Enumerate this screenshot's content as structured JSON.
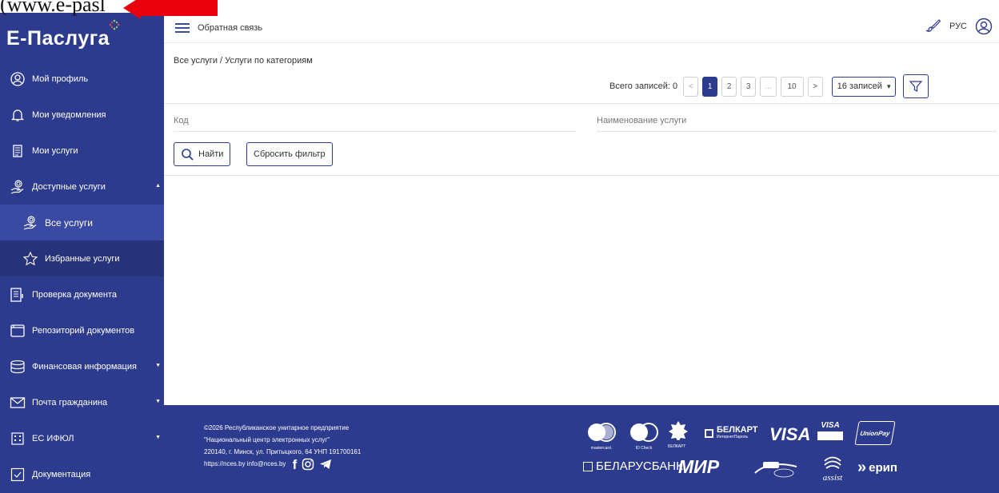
{
  "overlay": {
    "text": "(www.e-pasl"
  },
  "logo": {
    "text": "Е-Паслуга"
  },
  "sidebar": {
    "items": [
      {
        "label": "Мой профиль"
      },
      {
        "label": "Мои уведомления"
      },
      {
        "label": "Мои услуги"
      },
      {
        "label": "Доступные услуги"
      },
      {
        "label": "Все услуги"
      },
      {
        "label": "Избранные услуги"
      },
      {
        "label": "Проверка документа"
      },
      {
        "label": "Репозиторий документов"
      },
      {
        "label": "Финансовая информация"
      },
      {
        "label": "Почта гражданина"
      },
      {
        "label": "ЕС ИФЮЛ"
      },
      {
        "label": "Документация"
      }
    ]
  },
  "header": {
    "feedback": "Обратная связь",
    "lang": "РУС"
  },
  "breadcrumb": "Все услуги / Услуги по категориям",
  "pager": {
    "total_label": "Всего записей: 0",
    "prev": "<",
    "pages": [
      "1",
      "2",
      "3",
      "...",
      "10"
    ],
    "next": ">",
    "per_page": "16 записей"
  },
  "filters": {
    "code_label": "Код",
    "name_label": "Наименование услуги"
  },
  "buttons": {
    "find": "Найти",
    "reset": "Сбросить фильтр"
  },
  "footer": {
    "line1": "©2026 Республиканское унитарное предприятие",
    "line2": "\"Национальный центр электронных услуг\"",
    "line3": "220140, г. Минск, ул. Притыцкого, 64  УНП 191700161",
    "line4": "https://nces.by  info@nces.by",
    "payments": {
      "mastercard": "mastercard.",
      "mc_idcheck": "ID Check",
      "belkart_small": "БЕЛКАРТ",
      "belkart": "БЕЛКАРТ",
      "belkart_sub": "ИнтернетПароль",
      "visa": "VISA",
      "visa_secure": "VISA",
      "unionpay": "UnionPay",
      "belarusbank": "БЕЛАРУСБАНК",
      "mir": "МИР",
      "assist": "assist",
      "erip": "ерип"
    }
  },
  "colors": {
    "primary": "#2d3b8e",
    "accent_red": "#e8000c"
  }
}
